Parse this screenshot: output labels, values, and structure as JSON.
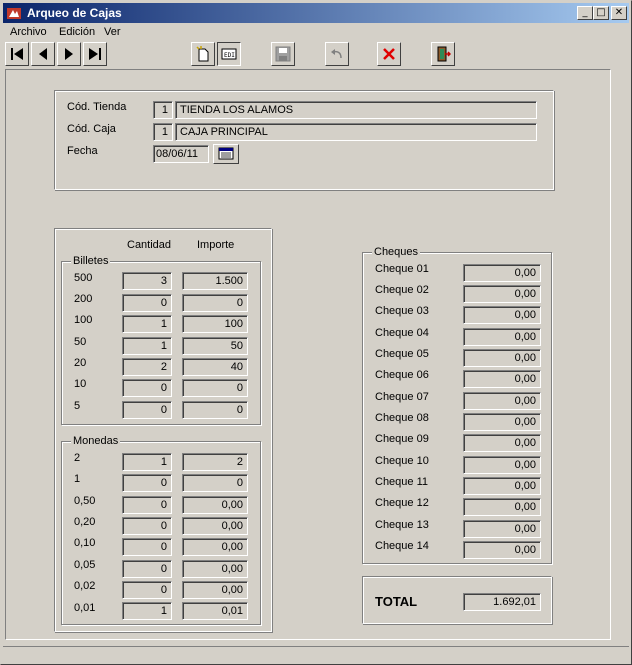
{
  "window": {
    "title": "Arqueo de Cajas",
    "minimize": "_",
    "maximize": "□",
    "close": "✕"
  },
  "menu": [
    {
      "label": "Archivo"
    },
    {
      "label": "Edición"
    },
    {
      "label": "Ver"
    }
  ],
  "toolbar": {
    "first": "first-record-icon",
    "prev": "previous-record-icon",
    "next": "next-record-icon",
    "last": "last-record-icon",
    "new": "new-document-icon",
    "edit": "edit-icon",
    "save": "save-icon",
    "undo": "undo-icon",
    "delete": "delete-icon",
    "exit": "exit-icon"
  },
  "header": {
    "tienda_label": "Cód. Tienda",
    "tienda_code": "1",
    "tienda_name": "TIENDA LOS ALAMOS",
    "caja_label": "Cód. Caja",
    "caja_code": "1",
    "caja_name": "CAJA PRINCIPAL",
    "fecha_label": "Fecha",
    "fecha_value": "08/06/11"
  },
  "columns": {
    "cantidad": "Cantidad",
    "importe": "Importe"
  },
  "billetes": {
    "label": "Billetes",
    "rows": [
      {
        "denom": "500",
        "cantidad": "3",
        "importe": "1.500"
      },
      {
        "denom": "200",
        "cantidad": "0",
        "importe": "0"
      },
      {
        "denom": "100",
        "cantidad": "1",
        "importe": "100"
      },
      {
        "denom": "50",
        "cantidad": "1",
        "importe": "50"
      },
      {
        "denom": "20",
        "cantidad": "2",
        "importe": "40"
      },
      {
        "denom": "10",
        "cantidad": "0",
        "importe": "0"
      },
      {
        "denom": "5",
        "cantidad": "0",
        "importe": "0"
      }
    ]
  },
  "monedas": {
    "label": "Monedas",
    "rows": [
      {
        "denom": "2",
        "cantidad": "1",
        "importe": "2"
      },
      {
        "denom": "1",
        "cantidad": "0",
        "importe": "0"
      },
      {
        "denom": "0,50",
        "cantidad": "0",
        "importe": "0,00"
      },
      {
        "denom": "0,20",
        "cantidad": "0",
        "importe": "0,00"
      },
      {
        "denom": "0,10",
        "cantidad": "0",
        "importe": "0,00"
      },
      {
        "denom": "0,05",
        "cantidad": "0",
        "importe": "0,00"
      },
      {
        "denom": "0,02",
        "cantidad": "0",
        "importe": "0,00"
      },
      {
        "denom": "0,01",
        "cantidad": "1",
        "importe": "0,01"
      }
    ]
  },
  "cheques": {
    "label": "Cheques",
    "rows": [
      {
        "label": "Cheque 01",
        "value": "0,00"
      },
      {
        "label": "Cheque 02",
        "value": "0,00"
      },
      {
        "label": "Cheque 03",
        "value": "0,00"
      },
      {
        "label": "Cheque 04",
        "value": "0,00"
      },
      {
        "label": "Cheque 05",
        "value": "0,00"
      },
      {
        "label": "Cheque 06",
        "value": "0,00"
      },
      {
        "label": "Cheque 07",
        "value": "0,00"
      },
      {
        "label": "Cheque 08",
        "value": "0,00"
      },
      {
        "label": "Cheque 09",
        "value": "0,00"
      },
      {
        "label": "Cheque 10",
        "value": "0,00"
      },
      {
        "label": "Cheque 11",
        "value": "0,00"
      },
      {
        "label": "Cheque 12",
        "value": "0,00"
      },
      {
        "label": "Cheque 13",
        "value": "0,00"
      },
      {
        "label": "Cheque 14",
        "value": "0,00"
      }
    ]
  },
  "total": {
    "label": "TOTAL",
    "value": "1.692,01"
  }
}
